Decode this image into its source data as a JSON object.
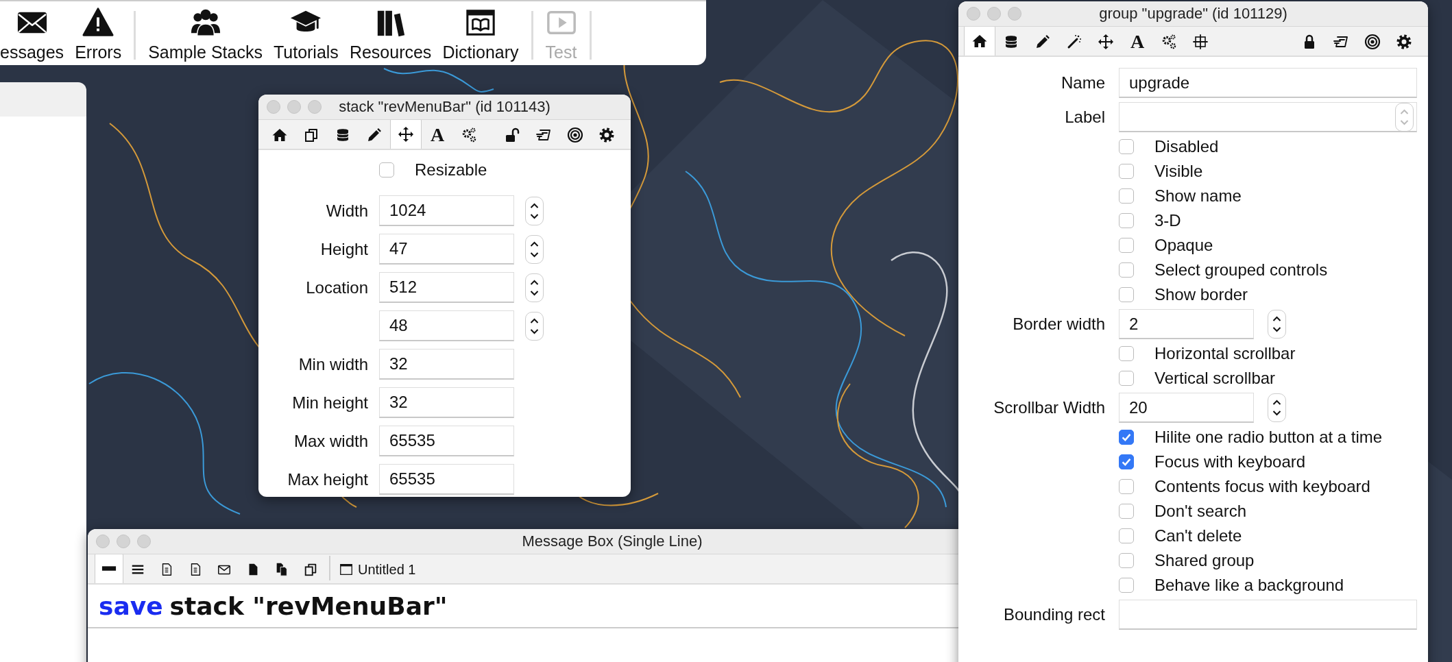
{
  "toolbar": {
    "items": [
      {
        "kind": "envelope",
        "label": "essages",
        "disabled": false
      },
      {
        "kind": "warning",
        "label": "Errors",
        "disabled": false
      },
      {
        "kind": "separator"
      },
      {
        "kind": "people",
        "label": "Sample Stacks",
        "disabled": false
      },
      {
        "kind": "cap",
        "label": "Tutorials",
        "disabled": false
      },
      {
        "kind": "books",
        "label": "Resources",
        "disabled": false
      },
      {
        "kind": "dictionary",
        "label": "Dictionary",
        "disabled": false
      },
      {
        "kind": "separator"
      },
      {
        "kind": "tablet",
        "label": "Test",
        "disabled": true
      },
      {
        "kind": "separator"
      }
    ]
  },
  "stack_window": {
    "title": "stack \"revMenuBar\" (id 101143)",
    "tabs": [
      {
        "kind": "home",
        "selected": false
      },
      {
        "kind": "cards",
        "selected": false
      },
      {
        "kind": "database",
        "selected": false
      },
      {
        "kind": "pencil",
        "selected": false
      },
      {
        "kind": "move",
        "selected": true
      },
      {
        "kind": "text",
        "glyph": "A",
        "selected": false
      },
      {
        "kind": "gears",
        "selected": false
      }
    ],
    "tools": [
      {
        "kind": "unlock"
      },
      {
        "kind": "note"
      },
      {
        "kind": "target"
      },
      {
        "kind": "gear"
      }
    ],
    "resizable": {
      "label": "Resizable",
      "checked": false
    },
    "fields": [
      {
        "label": "Width",
        "value": "1024",
        "stepper": true
      },
      {
        "label": "Height",
        "value": "47",
        "stepper": true
      },
      {
        "label": "Location",
        "value": "512",
        "stepper": true
      },
      {
        "value": "48",
        "stepper": true
      },
      {
        "label": "Min width",
        "value": "32",
        "stepper": false
      },
      {
        "label": "Min height",
        "value": "32",
        "stepper": false
      },
      {
        "label": "Max width",
        "value": "65535",
        "stepper": false
      },
      {
        "label": "Max height",
        "value": "65535",
        "stepper": false
      }
    ]
  },
  "group_window": {
    "title": "group \"upgrade\" (id 101129)",
    "tabs": [
      {
        "kind": "home",
        "selected": true
      },
      {
        "kind": "database",
        "selected": false
      },
      {
        "kind": "pencil",
        "selected": false
      },
      {
        "kind": "wand",
        "selected": false
      },
      {
        "kind": "move",
        "selected": false
      },
      {
        "kind": "text",
        "glyph": "A",
        "selected": false
      },
      {
        "kind": "gears",
        "selected": false
      },
      {
        "kind": "geometry",
        "selected": false
      }
    ],
    "tools": [
      {
        "kind": "lock"
      },
      {
        "kind": "note"
      },
      {
        "kind": "target"
      },
      {
        "kind": "gear"
      }
    ],
    "rows": [
      {
        "kind": "field",
        "label": "Name",
        "value": "upgrade",
        "stepper": false
      },
      {
        "kind": "field",
        "label": "Label",
        "stepper": true,
        "stepper_disabled": true
      },
      {
        "kind": "checkbox",
        "label": "Disabled",
        "checked": false
      },
      {
        "kind": "checkbox",
        "label": "Visible",
        "checked": false
      },
      {
        "kind": "checkbox",
        "label": "Show name",
        "checked": false
      },
      {
        "kind": "checkbox",
        "label": "3-D",
        "checked": false
      },
      {
        "kind": "checkbox",
        "label": "Opaque",
        "checked": false
      },
      {
        "kind": "checkbox",
        "label": "Select grouped controls",
        "checked": false
      },
      {
        "kind": "checkbox",
        "label": "Show border",
        "checked": false
      },
      {
        "kind": "field",
        "label": "Border width",
        "value": "2",
        "stepper": true,
        "stepper_disabled": false
      },
      {
        "kind": "checkbox",
        "label": "Horizontal scrollbar",
        "checked": false
      },
      {
        "kind": "checkbox",
        "label": "Vertical scrollbar",
        "checked": false
      },
      {
        "kind": "field",
        "label": "Scrollbar Width",
        "value": "20",
        "stepper": true,
        "stepper_disabled": false
      },
      {
        "kind": "checkbox",
        "label": "Hilite one radio button at a time",
        "checked": true
      },
      {
        "kind": "checkbox",
        "label": "Focus with keyboard",
        "checked": true
      },
      {
        "kind": "checkbox",
        "label": "Contents focus with keyboard",
        "checked": false
      },
      {
        "kind": "checkbox",
        "label": "Don't search",
        "checked": false
      },
      {
        "kind": "checkbox",
        "label": "Can't delete",
        "checked": false
      },
      {
        "kind": "checkbox",
        "label": "Shared group",
        "checked": false
      },
      {
        "kind": "checkbox",
        "label": "Behave like a background",
        "checked": false
      },
      {
        "kind": "field",
        "label": "Bounding rect",
        "stepper": false
      }
    ]
  },
  "message_box": {
    "title": "Message Box (Single Line)",
    "tabs": [
      {
        "kind": "dash",
        "selected": true
      },
      {
        "kind": "lines",
        "selected": false
      },
      {
        "kind": "doc",
        "selected": false
      },
      {
        "kind": "doc",
        "selected": false
      },
      {
        "kind": "mail",
        "selected": false
      },
      {
        "kind": "file",
        "selected": false
      },
      {
        "kind": "files",
        "selected": false
      },
      {
        "kind": "cards",
        "selected": false
      }
    ],
    "document": "Untitled 1",
    "command": [
      {
        "kind": "keyword",
        "text": "save"
      },
      {
        "kind": "plain",
        "text": "stack \"revMenuBar\""
      }
    ]
  }
}
